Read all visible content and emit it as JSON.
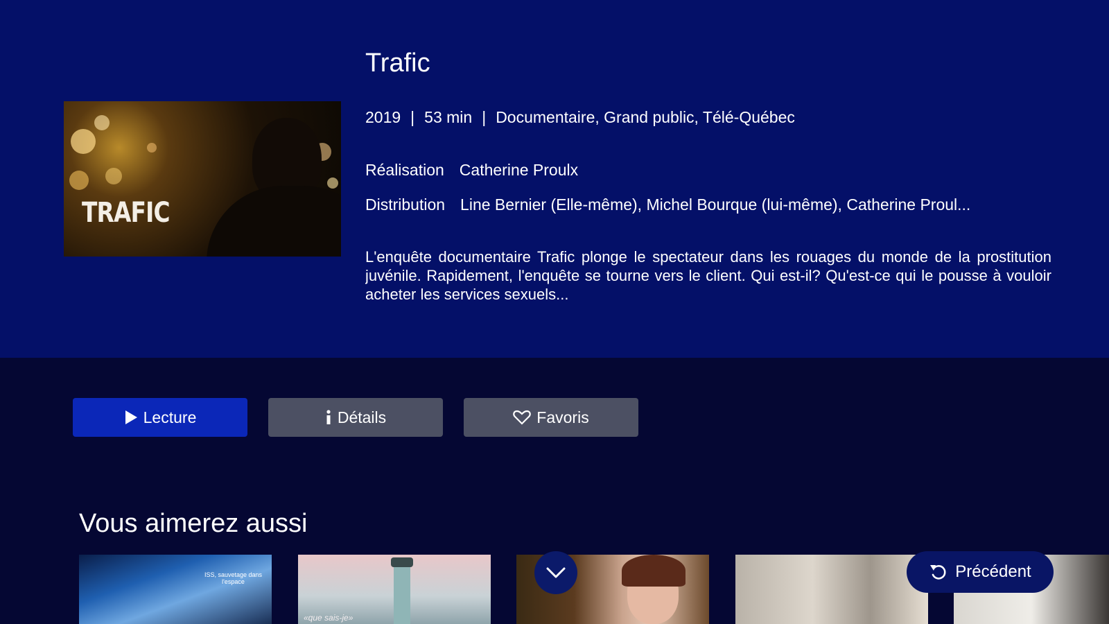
{
  "program": {
    "title": "Trafic",
    "poster_title": "TRAFIC",
    "year": "2019",
    "duration": "53 min",
    "genres": "Documentaire, Grand public, Télé-Québec",
    "separator": "|",
    "direction_label": "Réalisation",
    "direction_value": "Catherine Proulx",
    "cast_label": "Distribution",
    "cast_value": "Line Bernier (Elle-même), Michel Bourque (lui-même), Catherine Proul...",
    "synopsis": "L'enquête documentaire Trafic plonge le spectateur dans les rouages du monde de la prostitution juvénile. Rapidement, l'enquête se tourne vers le client. Qui est-il? Qu'est-ce qui le pousse à vouloir acheter les services sexuels..."
  },
  "actions": {
    "play_label": "Lecture",
    "play_icon": "play-icon",
    "details_label": "Détails",
    "details_icon": "info-icon",
    "favorites_label": "Favoris",
    "favorites_icon": "heart-icon"
  },
  "recommendations": {
    "title": "Vous aimerez aussi",
    "items": [
      {
        "caption": "ISS, sauvetage dans\nl'espace"
      },
      {
        "caption": "«que sais-je»"
      },
      {
        "caption": ""
      },
      {
        "caption": ""
      },
      {
        "caption": ""
      }
    ]
  },
  "controls": {
    "scroll_icon": "chevron-down-icon",
    "back_label": "Précédent",
    "back_icon": "undo-icon"
  },
  "colors": {
    "hero_bg": "#041068",
    "page_bg": "#050733",
    "play_button": "#0b27b8",
    "secondary_button": "#4c5063"
  }
}
